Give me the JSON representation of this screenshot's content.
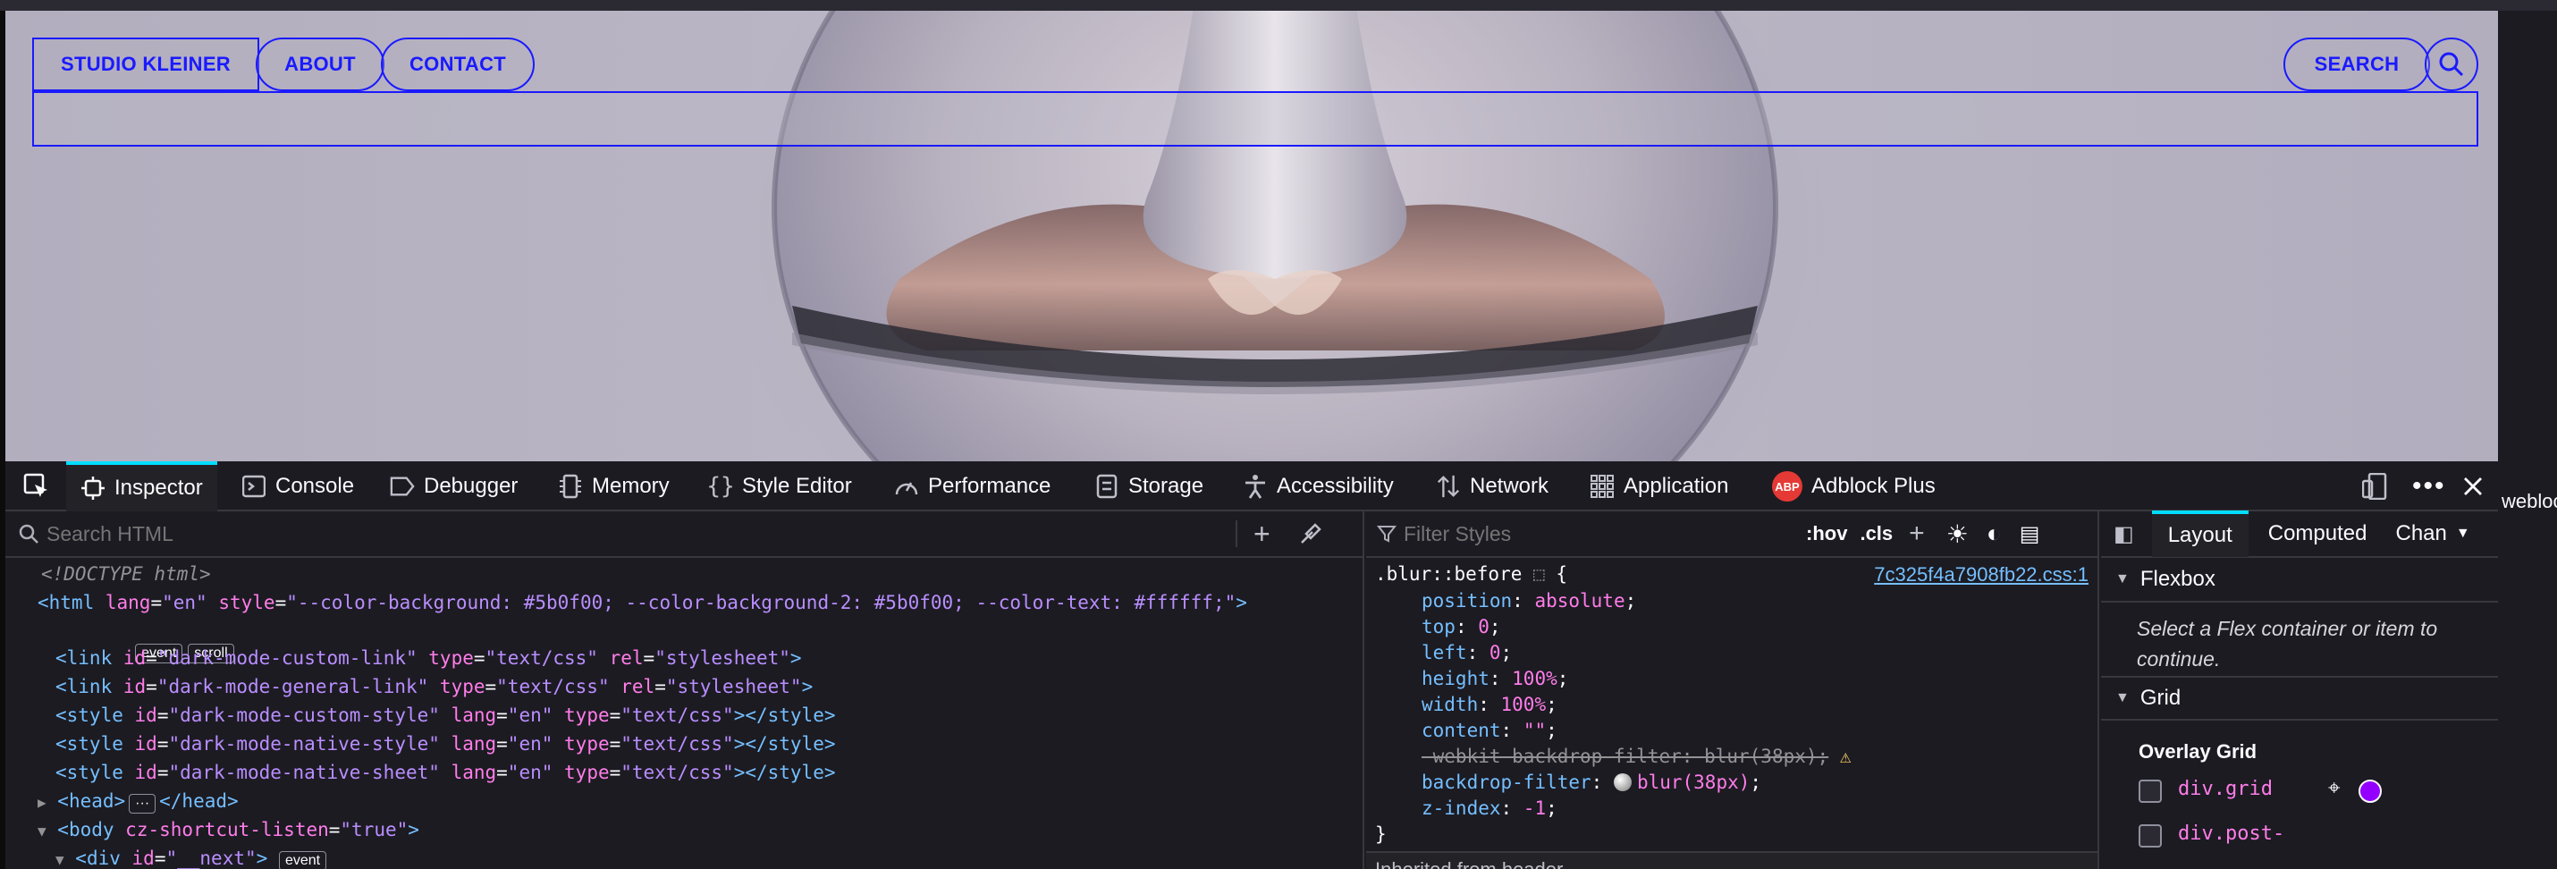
{
  "site": {
    "brand": "STUDIO KLEINER",
    "nav": {
      "about": "ABOUT",
      "contact": "CONTACT",
      "search": "SEARCH"
    }
  },
  "devtools": {
    "tabs": [
      {
        "label": "Inspector",
        "icon": "inspector-icon"
      },
      {
        "label": "Console",
        "icon": "console-icon"
      },
      {
        "label": "Debugger",
        "icon": "debugger-icon"
      },
      {
        "label": "Memory",
        "icon": "memory-icon"
      },
      {
        "label": "Style Editor",
        "icon": "style-editor-icon"
      },
      {
        "label": "Performance",
        "icon": "performance-icon"
      },
      {
        "label": "Storage",
        "icon": "storage-icon"
      },
      {
        "label": "Accessibility",
        "icon": "accessibility-icon"
      },
      {
        "label": "Network",
        "icon": "network-icon"
      },
      {
        "label": "Application",
        "icon": "application-icon"
      },
      {
        "label": "Adblock Plus",
        "icon": "adblock-plus-icon"
      }
    ],
    "abp_badge": "ABP",
    "overflow_text": "webloc",
    "html_panel": {
      "search_placeholder": "Search HTML",
      "doctype": "<!DOCTYPE html>",
      "html_open": {
        "tag": "<html",
        "lang_attr": "lang",
        "lang_val": "\"en\"",
        "style_attr": "style",
        "style_val": "\"--color-background: #5b0f00; --color-background-2: #5b0f00; --color-text: #ffffff;\"",
        "close": ">"
      },
      "badges": [
        "event",
        "scroll"
      ],
      "lines": [
        {
          "tag": "<link",
          "a1": "id",
          "v1": "\"dark-mode-custom-link\"",
          "a2": "type",
          "v2": "\"text/css\"",
          "a3": "rel",
          "v3": "\"stylesheet\"",
          "close": ">"
        },
        {
          "tag": "<link",
          "a1": "id",
          "v1": "\"dark-mode-general-link\"",
          "a2": "type",
          "v2": "\"text/css\"",
          "a3": "rel",
          "v3": "\"stylesheet\"",
          "close": ">"
        },
        {
          "tag": "<style",
          "a1": "id",
          "v1": "\"dark-mode-custom-style\"",
          "a2": "lang",
          "v2": "\"en\"",
          "a3": "type",
          "v3": "\"text/css\"",
          "close": "></style>"
        },
        {
          "tag": "<style",
          "a1": "id",
          "v1": "\"dark-mode-native-style\"",
          "a2": "lang",
          "v2": "\"en\"",
          "a3": "type",
          "v3": "\"text/css\"",
          "close": "></style>"
        },
        {
          "tag": "<style",
          "a1": "id",
          "v1": "\"dark-mode-native-sheet\"",
          "a2": "lang",
          "v2": "\"en\"",
          "a3": "type",
          "v3": "\"text/css\"",
          "close": "></style>"
        }
      ],
      "head": {
        "open": "<head>",
        "ellipsis": "···",
        "close": "</head>"
      },
      "body": {
        "tag": "<body",
        "attr": "cz-shortcut-listen",
        "val": "\"true\"",
        "close": ">"
      },
      "div": {
        "tag": "<div",
        "attr": "id",
        "val": "\"__next\"",
        "close": ">",
        "badge": "event"
      }
    },
    "rules_panel": {
      "filter_placeholder": "Filter Styles",
      "hov": ":hov",
      "cls": ".cls",
      "selector": ".blur::before",
      "open_brace": "{",
      "close_brace": "}",
      "source": "7c325f4a7908fb22.css:1",
      "declarations": [
        {
          "prop": "position",
          "value": "absolute",
          "struck": false
        },
        {
          "prop": "top",
          "value": "0",
          "struck": false
        },
        {
          "prop": "left",
          "value": "0",
          "struck": false
        },
        {
          "prop": "height",
          "value": "100%",
          "struck": false
        },
        {
          "prop": "width",
          "value": "100%",
          "struck": false
        },
        {
          "prop": "content",
          "value": "\"\"",
          "struck": false
        },
        {
          "prop": "-webkit-backdrop-filter",
          "value": "blur(38px)",
          "struck": true
        },
        {
          "prop": "backdrop-filter",
          "value": "blur(38px)",
          "struck": false
        },
        {
          "prop": "z-index",
          "value": "-1",
          "struck": false
        }
      ],
      "inherited": "Inherited from header"
    },
    "layout_panel": {
      "tabs": [
        "Layout",
        "Computed",
        "Chan"
      ],
      "flexbox": "Flexbox",
      "flex_hint": "Select a Flex container or item to continue.",
      "grid": "Grid",
      "overlay_grid": "Overlay Grid",
      "grid_items": [
        "div.grid",
        "div.post-"
      ],
      "grid_color": "#9400ff"
    }
  }
}
